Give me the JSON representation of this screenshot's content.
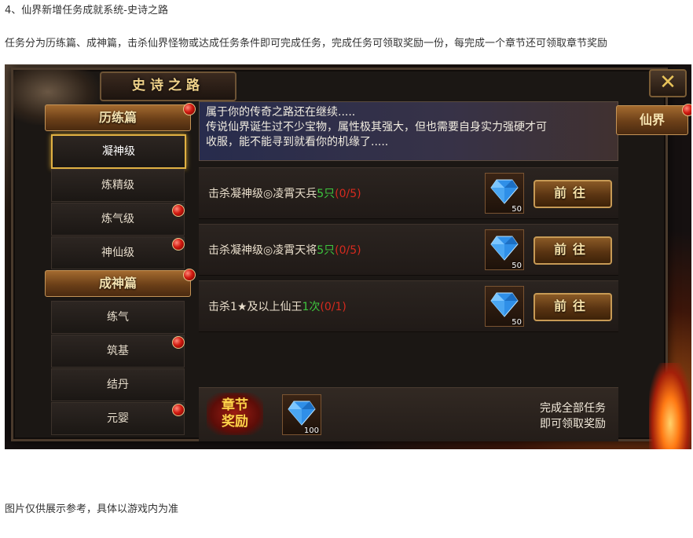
{
  "article": {
    "heading": "4、仙界新增任务成就系统-史诗之路",
    "intro": "任务分为历练篇、成神篇，击杀仙界怪物或达成任务条件即可完成任务，完成任务可领取奖励一份，每完成一个章节还可领取章节奖励",
    "footnote": "图片仅供展示参考，具体以游戏内为准"
  },
  "game": {
    "window_title": "史诗之路",
    "close_icon": "close-x-icon",
    "right_tab": "仙界",
    "sidebar": {
      "categories": [
        {
          "label": "历练篇",
          "has_alert": true,
          "items": [
            {
              "label": "凝神级",
              "active": true,
              "has_alert": false
            },
            {
              "label": "炼精级",
              "active": false,
              "has_alert": false
            },
            {
              "label": "炼气级",
              "active": false,
              "has_alert": true
            },
            {
              "label": "神仙级",
              "active": false,
              "has_alert": true
            }
          ]
        },
        {
          "label": "成神篇",
          "has_alert": true,
          "items": [
            {
              "label": "练气",
              "active": false,
              "has_alert": false
            },
            {
              "label": "筑基",
              "active": false,
              "has_alert": true
            },
            {
              "label": "结丹",
              "active": false,
              "has_alert": false
            },
            {
              "label": "元婴",
              "active": false,
              "has_alert": true
            }
          ]
        }
      ]
    },
    "story": {
      "line1": "属于你的传奇之路还在继续.....",
      "line2": "传说仙界诞生过不少宝物，属性极其强大，但也需要自身实力强硬才可",
      "line3": "收服，能不能寻到就看你的机缘了....."
    },
    "tasks": [
      {
        "prefix": "击杀凝神级◎凌霄天兵",
        "count": "5只",
        "progress": "(0/5)",
        "reward_icon": "blue-diamond-icon",
        "reward_qty": "50",
        "button": "前往"
      },
      {
        "prefix": "击杀凝神级◎凌霄天将",
        "count": "5只",
        "progress": "(0/5)",
        "reward_icon": "blue-diamond-icon",
        "reward_qty": "50",
        "button": "前往"
      },
      {
        "prefix": "击杀1★及以上仙王",
        "count": "1次",
        "progress": "(0/1)",
        "reward_icon": "blue-diamond-icon",
        "reward_qty": "50",
        "button": "前往"
      }
    ],
    "chapter_reward": {
      "badge_line1": "章节",
      "badge_line2": "奖励",
      "reward_icon": "blue-diamond-icon",
      "reward_qty": "100",
      "note_line1": "完成全部任务",
      "note_line2": "即可领取奖励"
    },
    "colors": {
      "count_green": "#3ec63e",
      "progress_red": "#d62a1e",
      "gold": "#e0b143"
    }
  }
}
